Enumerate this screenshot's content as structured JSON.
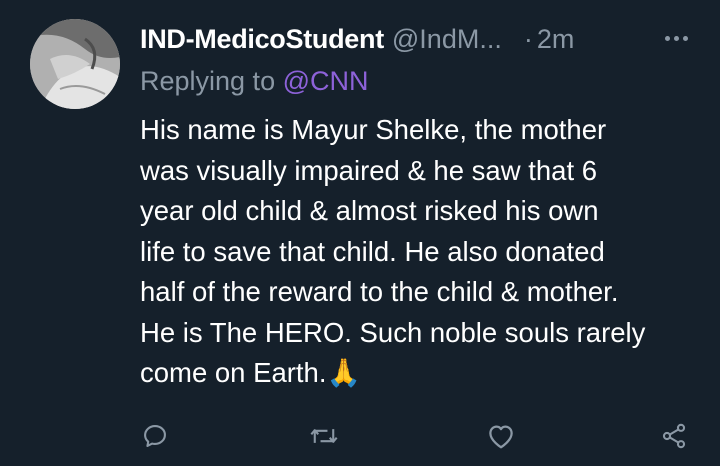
{
  "tweet": {
    "display_name": "IND-MedicoStudent",
    "handle": "@IndM...",
    "separator": "·",
    "time": "2m",
    "replying_prefix": "Replying to ",
    "replying_mention": "@CNN",
    "body_lines": [
      "His name is Mayur Shelke, the mother",
      "was visually impaired & he saw that 6",
      "year old child & almost risked his own",
      "life to save that child. He also donated",
      "half of the reward to the child & mother.",
      "He is The HERO. Such noble souls rarely",
      "come on Earth.🙏"
    ]
  },
  "icons": {
    "more": "more-horizontal-icon",
    "reply": "comment-icon",
    "retweet": "retweet-icon",
    "like": "heart-icon",
    "share": "share-icon"
  },
  "colors": {
    "background": "#15202b",
    "primary_text": "#ffffff",
    "secondary_text": "#8b98a5",
    "mention": "#8d62d9"
  }
}
